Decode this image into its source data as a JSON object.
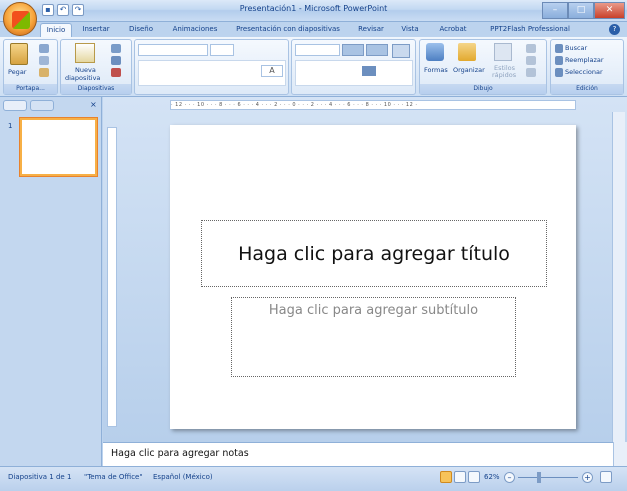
{
  "window": {
    "title": "Presentación1 - Microsoft PowerPoint",
    "minimize": "–",
    "restore": "□",
    "close": "✕"
  },
  "qat": {
    "save": "▪",
    "undo": "↶",
    "redo": "↷"
  },
  "tabs": [
    "Inicio",
    "Insertar",
    "Diseño",
    "Animaciones",
    "Presentación con diapositivas",
    "Revisar",
    "Vista",
    "Acrobat",
    "PPT2Flash Professional"
  ],
  "ribbon": {
    "groups": {
      "clipboard": "Portapa...",
      "slides": "Diapositivas",
      "drawing": "Dibujo",
      "editing": "Edición"
    },
    "paste": "Pegar",
    "new_slide": [
      "Nueva",
      "diapositiva"
    ],
    "shapes": "Formas",
    "arrange": "Organizar",
    "quick_styles": [
      "Estilos",
      "rápidos"
    ],
    "find": "Buscar",
    "replace": "Reemplazar",
    "select": "Seleccionar",
    "text_direction_a": "A"
  },
  "ruler": {
    "horizontal": "· 12 · · · 10 · · · 8 · · · 6 · · · 4 · · · 2 · · · 0 · · · 2 · · · 4 · · · 6 · · · 8 · · · 10 · · · 12 ·"
  },
  "thumbs": {
    "number": "1"
  },
  "slide": {
    "title_placeholder": "Haga clic para agregar título",
    "subtitle_placeholder": "Haga clic para agregar subtítulo"
  },
  "notes": "Haga clic para agregar notas",
  "status": {
    "slide": "Diapositiva 1 de 1",
    "theme": "\"Tema de Office\"",
    "language": "Español (México)",
    "zoom": "62%",
    "minus": "–",
    "plus": "+"
  },
  "colors": {
    "accent": "#15428b",
    "selection": "#f7b046"
  }
}
